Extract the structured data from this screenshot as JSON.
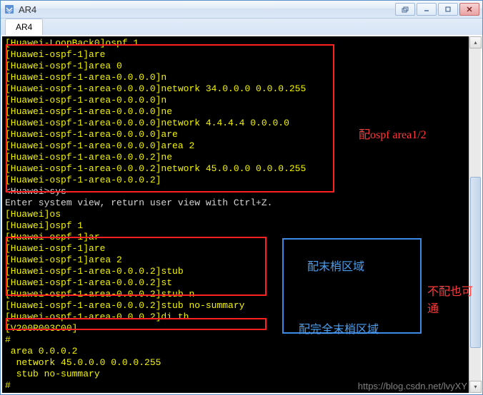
{
  "window": {
    "title": "AR4"
  },
  "tab": {
    "label": "AR4"
  },
  "terminal": {
    "lines": [
      {
        "cls": "y",
        "text": "[Huawei-LoopBack0]ospf 1"
      },
      {
        "cls": "y",
        "text": "[Huawei-ospf-1]are"
      },
      {
        "cls": "y",
        "text": "[Huawei-ospf-1]area 0"
      },
      {
        "cls": "y",
        "text": "[Huawei-ospf-1-area-0.0.0.0]n"
      },
      {
        "cls": "y",
        "text": "[Huawei-ospf-1-area-0.0.0.0]network 34.0.0.0 0.0.0.255"
      },
      {
        "cls": "y",
        "text": "[Huawei-ospf-1-area-0.0.0.0]n"
      },
      {
        "cls": "y",
        "text": "[Huawei-ospf-1-area-0.0.0.0]ne"
      },
      {
        "cls": "y",
        "text": "[Huawei-ospf-1-area-0.0.0.0]network 4.4.4.4 0.0.0.0"
      },
      {
        "cls": "y",
        "text": "[Huawei-ospf-1-area-0.0.0.0]are"
      },
      {
        "cls": "y",
        "text": "[Huawei-ospf-1-area-0.0.0.0]area 2"
      },
      {
        "cls": "y",
        "text": "[Huawei-ospf-1-area-0.0.0.2]ne"
      },
      {
        "cls": "y",
        "text": "[Huawei-ospf-1-area-0.0.0.2]network 45.0.0.0 0.0.0.255"
      },
      {
        "cls": "y",
        "text": "[Huawei-ospf-1-area-0.0.0.2]"
      },
      {
        "cls": "w",
        "text": "<Huawei>sys"
      },
      {
        "cls": "w",
        "text": "Enter system view, return user view with Ctrl+Z."
      },
      {
        "cls": "y",
        "text": "[Huawei]os"
      },
      {
        "cls": "y",
        "text": "[Huawei]ospf 1"
      },
      {
        "cls": "y",
        "text": "[Huawei-ospf-1]ar"
      },
      {
        "cls": "y",
        "text": "[Huawei-ospf-1]are"
      },
      {
        "cls": "y",
        "text": "[Huawei-ospf-1]area 2"
      },
      {
        "cls": "y",
        "text": "[Huawei-ospf-1-area-0.0.0.2]stub"
      },
      {
        "cls": "y",
        "text": "[Huawei-ospf-1-area-0.0.0.2]st"
      },
      {
        "cls": "y",
        "text": "[Huawei-ospf-1-area-0.0.0.2]stub n"
      },
      {
        "cls": "y",
        "text": "[Huawei-ospf-1-area-0.0.0.2]stub no-summary"
      },
      {
        "cls": "y",
        "text": "[Huawei-ospf-1-area-0.0.0.2]di th"
      },
      {
        "cls": "y",
        "text": "[V200R003C00]"
      },
      {
        "cls": "y",
        "text": "#"
      },
      {
        "cls": "y",
        "text": " area 0.0.0.2"
      },
      {
        "cls": "y",
        "text": "  network 45.0.0.0 0.0.0.255"
      },
      {
        "cls": "y",
        "text": "  stub no-summary"
      },
      {
        "cls": "y",
        "text": "#"
      }
    ]
  },
  "annotations": {
    "ospf_area": "配ospf area1/2",
    "stub_area": "配末梢区域",
    "no_config_ok": "不配也可通",
    "total_stub": "配完全末梢区域"
  },
  "watermark": "https://blog.csdn.net/lvyXY"
}
